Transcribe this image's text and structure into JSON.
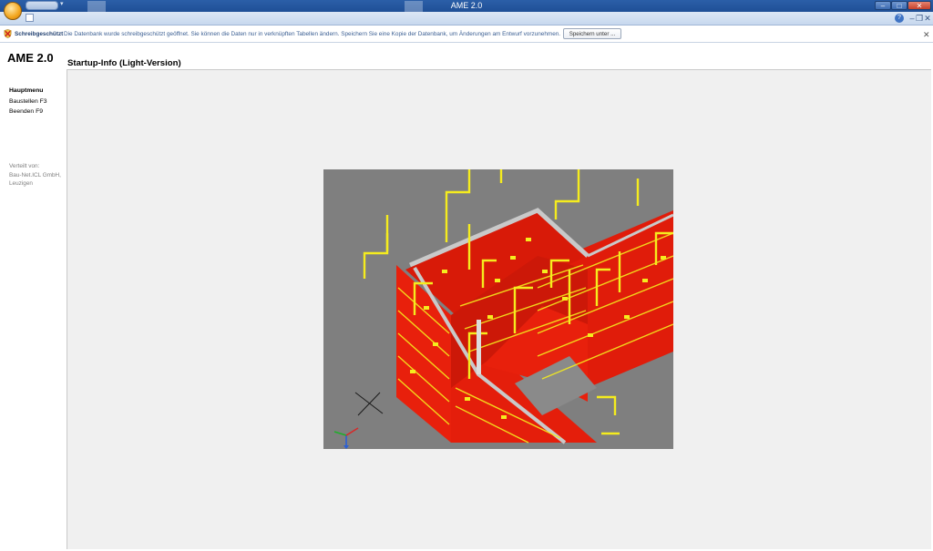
{
  "window": {
    "title": "AME 2.0"
  },
  "message_bar": {
    "title": "Schreibgeschützt",
    "text": "Die Datenbank wurde schreibgeschützt geöffnet. Sie können die Daten nur in verknüpften Tabellen ändern. Speichern Sie eine Kopie der Datenbank, um Änderungen am Entwurf vorzunehmen.",
    "button_label": "Speichern unter ..."
  },
  "app": {
    "title": "AME 2.0",
    "content_title": "Startup-Info (Light-Version)"
  },
  "sidebar": {
    "heading": "Hauptmenu",
    "items": [
      {
        "label": "Baustellen F3"
      },
      {
        "label": "Beenden F9"
      }
    ],
    "distributor_label": "Verteilt von:",
    "distributor_value": "Bau-Net.ICL GmbH, Leuzigen"
  },
  "colors": {
    "titlebar": "#1f4f96",
    "panel_background": "#f0f0f0",
    "image_background": "#7f7f7f",
    "formwork_red": "#e8200c",
    "formwork_yellow": "#f5ec1e"
  },
  "icons": {
    "office_button": "office-orb-icon",
    "message_bar": "shield-warning-icon",
    "help": "help-icon"
  }
}
